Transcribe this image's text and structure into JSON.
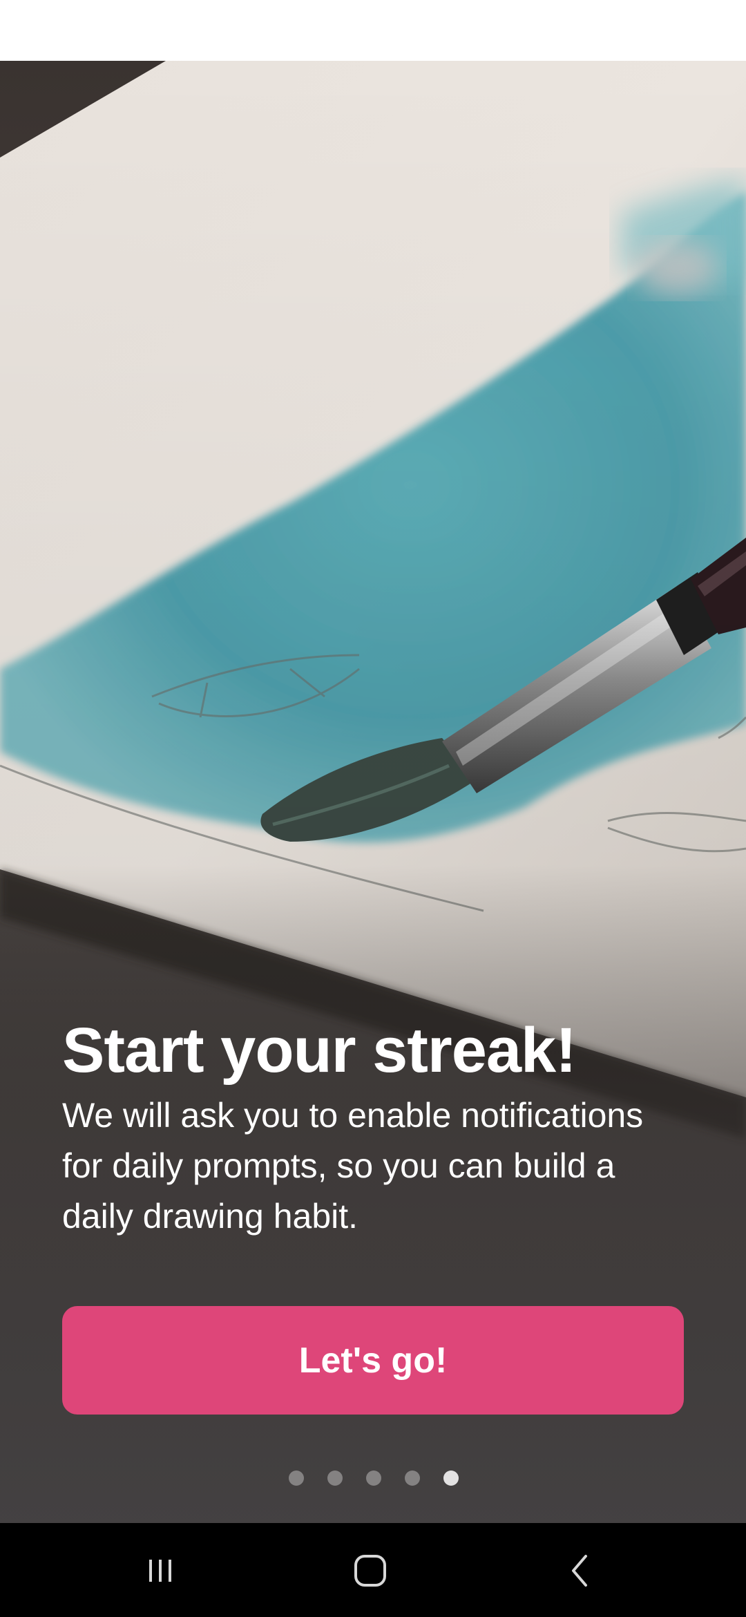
{
  "onboarding": {
    "title": "Start your streak!",
    "description": "We will ask you to enable notifications for daily prompts, so you can build a daily drawing habit.",
    "cta_label": "Let's go!",
    "page_indicator": {
      "total": 5,
      "current": 5
    },
    "hero_image": "watercolor-painting-brush-photo"
  },
  "colors": {
    "accent": "#DE4679",
    "status_bar_bg": "#FFFFFF",
    "nav_bar_bg": "#000000"
  },
  "nav_bar": {
    "recents_icon": "recents-icon",
    "home_icon": "home-icon",
    "back_icon": "back-icon"
  }
}
